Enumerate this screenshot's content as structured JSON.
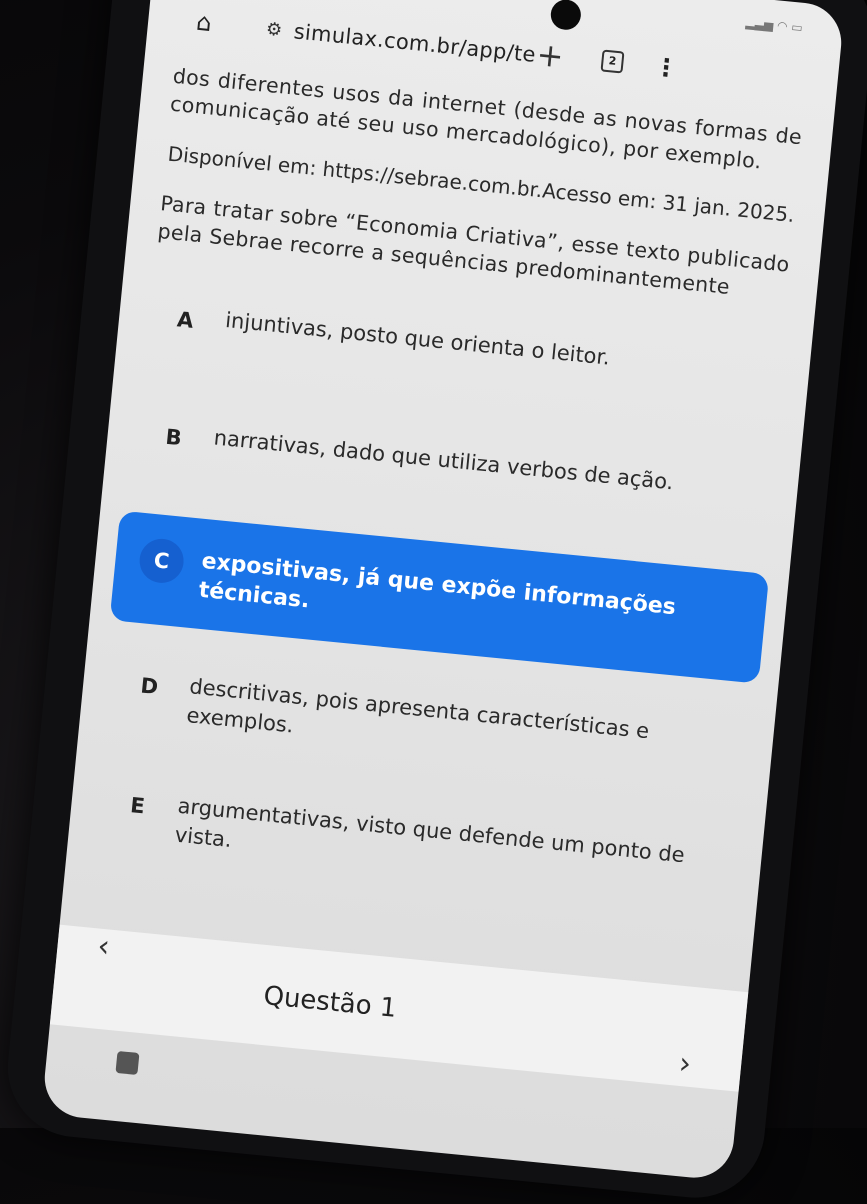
{
  "browser": {
    "url": "simulax.com.br/app/tе",
    "tab_count": "2"
  },
  "passage": {
    "text": "dos diferentes usos da internet (desde as novas formas de comunicação até seu uso mercadológico), por exemplo.",
    "source": "Disponível em: https://sebrae.com.br.Acesso em: 31 jan. 2025."
  },
  "question": {
    "stem": "Para tratar sobre “Economia Criativa”, esse texto publicado pela Sebrae recorre a sequências predominantemente"
  },
  "options": [
    {
      "letter": "A",
      "text": "injuntivas, posto que orienta o leitor."
    },
    {
      "letter": "B",
      "text": "narrativas, dado que utiliza verbos de ação."
    },
    {
      "letter": "C",
      "text": "expositivas, já que expõe informações técnicas."
    },
    {
      "letter": "D",
      "text": "descritivas, pois apresenta características e exemplos."
    },
    {
      "letter": "E",
      "text": "argumentativas, visto que defende um ponto de vista."
    }
  ],
  "selected_option": "C",
  "navigation": {
    "question_label": "Questão 1"
  },
  "colors": {
    "selected_bg": "#1a74e8",
    "screen_bg": "#e8e8e8"
  }
}
